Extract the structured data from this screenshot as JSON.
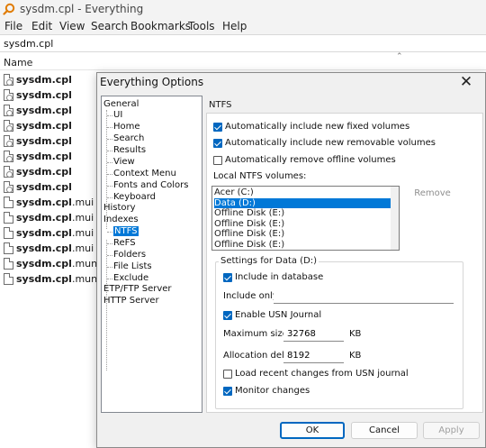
{
  "window": {
    "title": "sysdm.cpl - Everything"
  },
  "menu": [
    "File",
    "Edit",
    "View",
    "Search",
    "Bookmarks",
    "Tools",
    "Help"
  ],
  "search": {
    "value": "sysdm.cpl"
  },
  "results": {
    "column_name": "Name",
    "rows": [
      {
        "bold": "sysdm.cpl",
        "rest": ""
      },
      {
        "bold": "sysdm.cpl",
        "rest": ""
      },
      {
        "bold": "sysdm.cpl",
        "rest": ""
      },
      {
        "bold": "sysdm.cpl",
        "rest": ""
      },
      {
        "bold": "sysdm.cpl",
        "rest": ""
      },
      {
        "bold": "sysdm.cpl",
        "rest": ""
      },
      {
        "bold": "sysdm.cpl",
        "rest": ""
      },
      {
        "bold": "sysdm.cpl",
        "rest": ""
      },
      {
        "bold": "sysdm.cpl",
        "rest": ".mui"
      },
      {
        "bold": "sysdm.cpl",
        "rest": ".mui"
      },
      {
        "bold": "sysdm.cpl",
        "rest": ".mui"
      },
      {
        "bold": "sysdm.cpl",
        "rest": ".mui"
      },
      {
        "bold": "sysdm.cpl",
        "rest": ".mun"
      },
      {
        "bold": "sysdm.cpl",
        "rest": ".mun"
      }
    ]
  },
  "dialog": {
    "title": "Everything Options",
    "tree": {
      "general": "General",
      "general_children": [
        "UI",
        "Home",
        "Search",
        "Results",
        "View",
        "Context Menu",
        "Fonts and Colors",
        "Keyboard"
      ],
      "history": "History",
      "indexes": "Indexes",
      "indexes_children": [
        "NTFS",
        "ReFS",
        "Folders",
        "File Lists",
        "Exclude"
      ],
      "etp": "ETP/FTP Server",
      "http": "HTTP Server"
    },
    "panel_title": "NTFS",
    "auto_fixed": "Automatically include new fixed volumes",
    "auto_removable": "Automatically include new removable volumes",
    "auto_remove_offline": "Automatically remove offline volumes",
    "local_volumes_label": "Local NTFS volumes:",
    "volumes": [
      "Acer (C:)",
      "Data (D:)",
      "Offline Disk (E:)",
      "Offline Disk (E:)",
      "Offline Disk (E:)",
      "Offline Disk (E:)",
      "Offline Disk (E:)"
    ],
    "remove": "Remove",
    "settings_title": "Settings for Data (D:)",
    "include_in_db": "Include in database",
    "include_only": "Include only:",
    "include_only_value": "",
    "enable_usn": "Enable USN Journal",
    "max_size_label": "Maximum size:",
    "max_size": "32768",
    "alloc_label": "Allocation delta:",
    "alloc": "8192",
    "kb": "KB",
    "load_recent": "Load recent changes from USN journal",
    "monitor": "Monitor changes",
    "ok": "OK",
    "cancel": "Cancel",
    "apply": "Apply"
  }
}
